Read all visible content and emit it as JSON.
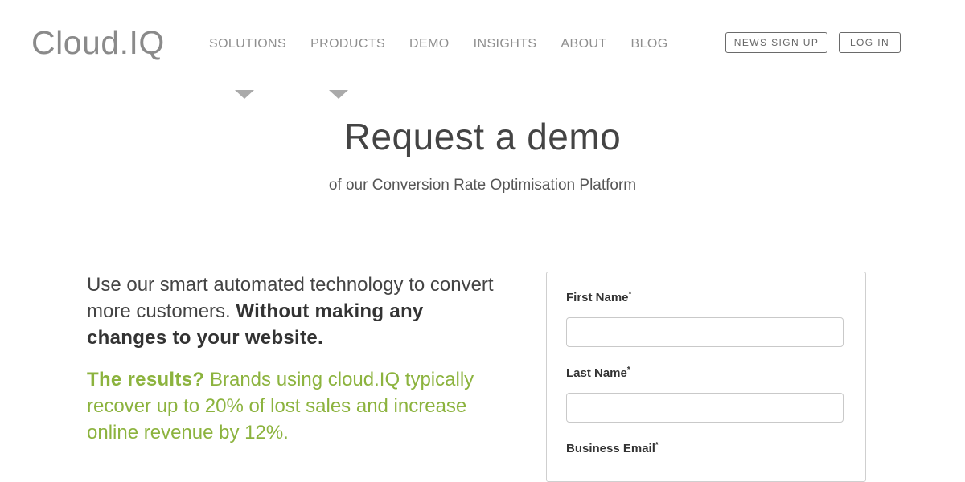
{
  "header": {
    "logo": "Cloud.IQ",
    "nav": [
      "SOLUTIONS",
      "PRODUCTS",
      "DEMO",
      "INSIGHTS",
      "ABOUT",
      "BLOG"
    ],
    "news_signup": "NEWS SIGN UP",
    "login": "LOG IN"
  },
  "hero": {
    "title": "Request a demo",
    "subtitle": "of our Conversion Rate Optimisation Platform"
  },
  "intro": {
    "text": "Use our smart automated technology to convert more customers.",
    "bold": "Without making any changes to your website."
  },
  "results": {
    "lead": "The results?",
    "text": "Brands using cloud.IQ typically recover up to 20% of lost sales and increase online revenue by 12%."
  },
  "form": {
    "first_name_label": "First Name",
    "last_name_label": "Last Name",
    "email_label": "Business Email",
    "required_mark": "*"
  },
  "colors": {
    "accent_green": "#8cb33e",
    "nav_gray": "#8f8f8f"
  }
}
